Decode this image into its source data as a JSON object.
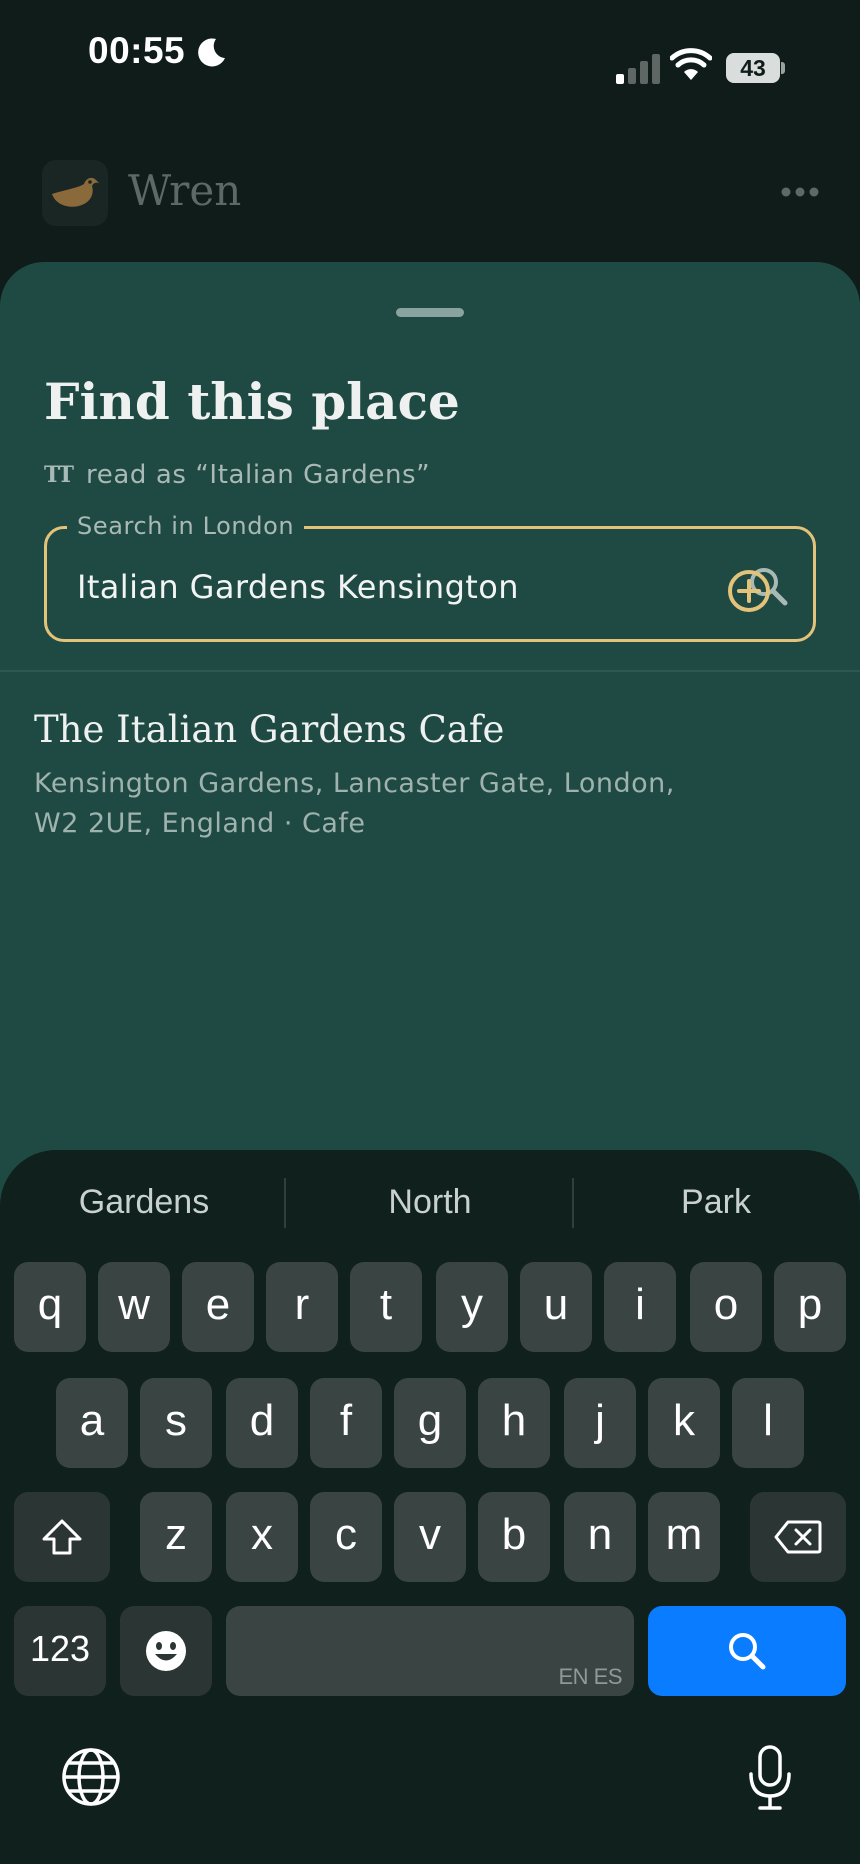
{
  "status_bar": {
    "time": "00:55",
    "battery": "43",
    "icons": [
      "moon-icon",
      "cellular-signal-icon",
      "wifi-icon",
      "battery-icon"
    ]
  },
  "app_header": {
    "name": "Wren",
    "logo_icon": "bird-icon",
    "more_icon": "ellipsis-icon"
  },
  "sheet": {
    "title": "Find this place",
    "read_as": "read as “Italian Gardens”",
    "read_as_icon": "text-size-icon",
    "search": {
      "label": "Search in London",
      "value": "Italian Gardens Kensington",
      "icon": "search-icon"
    },
    "results": [
      {
        "name": "The Italian Gardens Cafe",
        "address": "Kensington Gardens, Lancaster Gate, London, W2 2UE, England · Cafe",
        "action_icon": "add-circle-icon"
      }
    ]
  },
  "keyboard": {
    "suggestions": [
      "Gardens",
      "North",
      "Park"
    ],
    "row1": [
      "q",
      "w",
      "e",
      "r",
      "t",
      "y",
      "u",
      "i",
      "o",
      "p"
    ],
    "row2": [
      "a",
      "s",
      "d",
      "f",
      "g",
      "h",
      "j",
      "k",
      "l"
    ],
    "row3": [
      "z",
      "x",
      "c",
      "v",
      "b",
      "n",
      "m"
    ],
    "numbers_key": "123",
    "space_hint": "EN ES",
    "accent_color": "#0a7cff",
    "field_border_color": "#e3c27a"
  }
}
